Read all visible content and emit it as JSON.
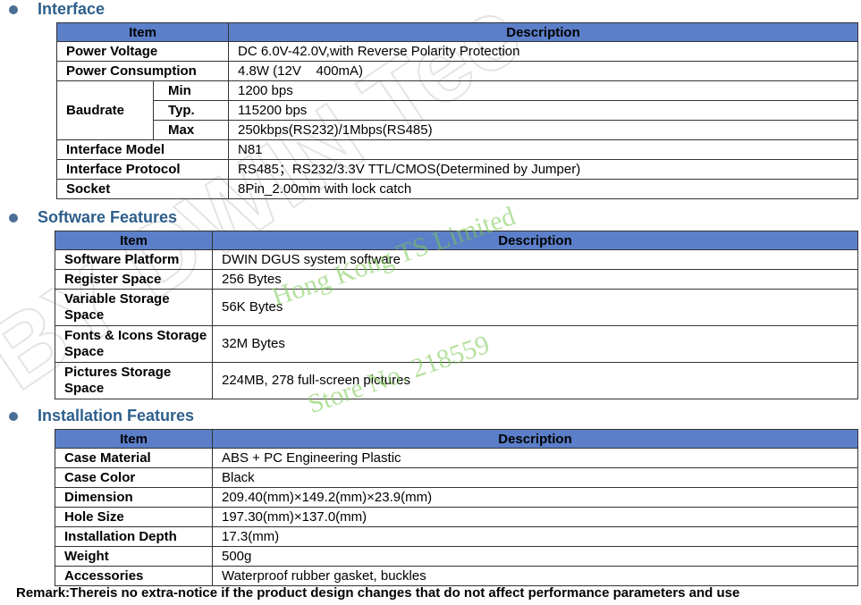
{
  "sections": [
    {
      "heading": "Interface",
      "header": {
        "item": "Item",
        "description": "Description"
      },
      "power_voltage": {
        "label": "Power Voltage",
        "value": "DC 6.0V-42.0V,with Reverse Polarity Protection"
      },
      "power_consumption": {
        "label": "Power Consumption",
        "value": "4.8W (12V    400mA)"
      },
      "baudrate": {
        "label": "Baudrate",
        "rows": [
          {
            "label": "Min",
            "value": "1200 bps"
          },
          {
            "label": "Typ.",
            "value": "115200 bps"
          },
          {
            "label": "Max",
            "value": "250kbps(RS232)/1Mbps(RS485)"
          }
        ]
      },
      "interface_model": {
        "label": "Interface Model",
        "value": "N81"
      },
      "interface_protocol": {
        "label": "Interface Protocol",
        "value": "RS485；RS232/3.3V TTL/CMOS(Determined by Jumper)"
      },
      "socket": {
        "label": "Socket",
        "value": "8Pin_2.00mm with lock catch"
      }
    },
    {
      "heading": "Software Features",
      "header": {
        "item": "Item",
        "description": "Description"
      },
      "rows": [
        {
          "label": "Software Platform",
          "value": "DWIN DGUS system software"
        },
        {
          "label": "Register Space",
          "value": "256 Bytes"
        },
        {
          "label": "Variable Storage Space",
          "value": "56K Bytes"
        },
        {
          "label": "Fonts & Icons Storage Space",
          "value": "32M Bytes"
        },
        {
          "label": "Pictures Storage Space",
          "value": "224MB, 278 full-screen pictures"
        }
      ]
    },
    {
      "heading": "Installation Features",
      "header": {
        "item": "Item",
        "description": "Description"
      },
      "rows": [
        {
          "label": "Case Material",
          "value": "ABS + PC Engineering Plastic"
        },
        {
          "label": "Case Color",
          "value": "Black"
        },
        {
          "label": "Dimension",
          "value": "209.40(mm)×149.2(mm)×23.9(mm)"
        },
        {
          "label": "Hole Size",
          "value": "197.30(mm)×137.0(mm)"
        },
        {
          "label": "Installation Depth",
          "value": "17.3(mm)"
        },
        {
          "label": "Weight",
          "value": "500g"
        },
        {
          "label": "Accessories",
          "value": "Waterproof rubber gasket, buckles"
        }
      ]
    }
  ],
  "remark": "Remark:Thereis no extra-notice if the product design changes that do not affect performance parameters and use",
  "watermarks": {
    "line1": "Hong Kong TS Limited",
    "line2": "Store No. 218559",
    "large": "BY DWIN Tec"
  },
  "colors": {
    "heading": "#2e5f8c",
    "header_fill": "#5b7fc9",
    "watermark": "#78c850"
  }
}
